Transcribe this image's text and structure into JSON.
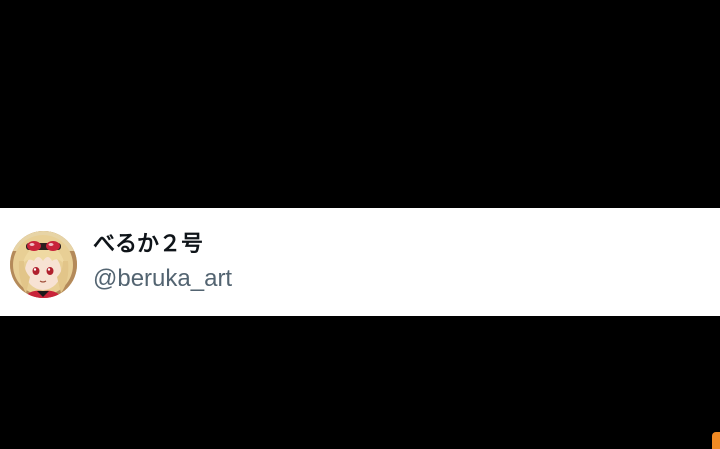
{
  "profile": {
    "display_name": "べるか２号",
    "handle": "@beruka_art"
  },
  "icons": {
    "avatar": "anime-girl-avatar-icon"
  },
  "colors": {
    "background": "#000000",
    "card": "#ffffff",
    "name_text": "#0f1419",
    "handle_text": "#536471",
    "edge_accent": "#f08a24"
  }
}
